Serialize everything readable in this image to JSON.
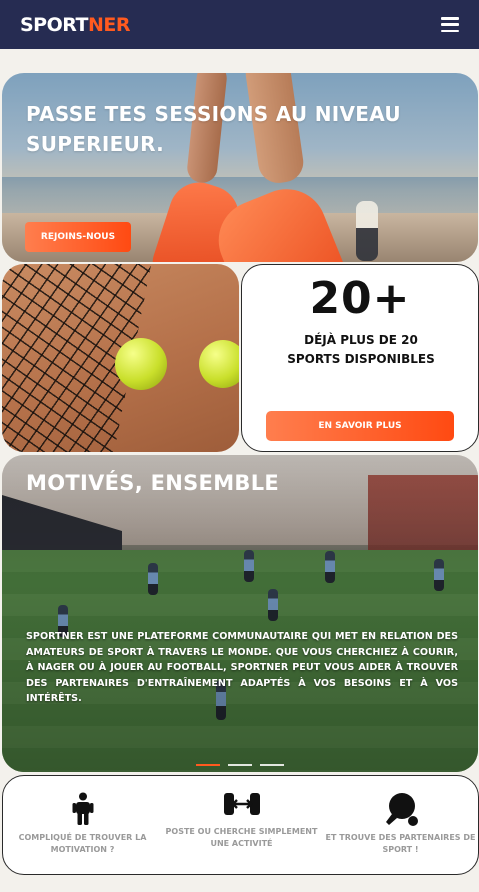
{
  "header": {
    "logo_part1": "SPORT",
    "logo_part2": "NER",
    "menu_icon": "hamburger-menu-icon",
    "bg_color": "#262c52",
    "accent_color": "#ff5a1f"
  },
  "hero": {
    "title": "PASSE TES SESSIONS AU NIVEAU SUPERIEUR.",
    "cta_label": "REJOINS-NOUS"
  },
  "stat": {
    "number": "20+",
    "text": "DÉJÀ PLUS DE 20 SPORTS DISPONIBLES",
    "cta_label": "EN SAVOIR PLUS"
  },
  "community": {
    "title": "MOTIVÉS, ENSEMBLE",
    "text": "SPORTNER EST UNE PLATEFORME COMMUNAUTAIRE QUI MET EN RELATION DES AMATEURS DE SPORT À TRAVERS LE MONDE. QUE VOUS CHERCHIEZ À COURIR, À NAGER OU À JOUER AU FOOTBALL, SPORTNER PEUT VOUS AIDER À TROUVER DES PARTENAIRES D'ENTRAÎNEMENT ADAPTÉS À VOS BESOINS ET À VOS INTÉRÊTS.",
    "carousel_active_index": 0,
    "carousel_count": 3
  },
  "features": [
    {
      "icon": "person-icon",
      "label": "COMPLIQUÉ DE TROUVER LA MOTIVATION ?"
    },
    {
      "icon": "dumbbell-icon",
      "label": "POSTE OU CHERCHE SIMPLEMENT UNE ACTIVITÉ"
    },
    {
      "icon": "ping-pong-icon",
      "label": "ET TROUVE DES PARTENAIRES DE SPORT !"
    }
  ]
}
